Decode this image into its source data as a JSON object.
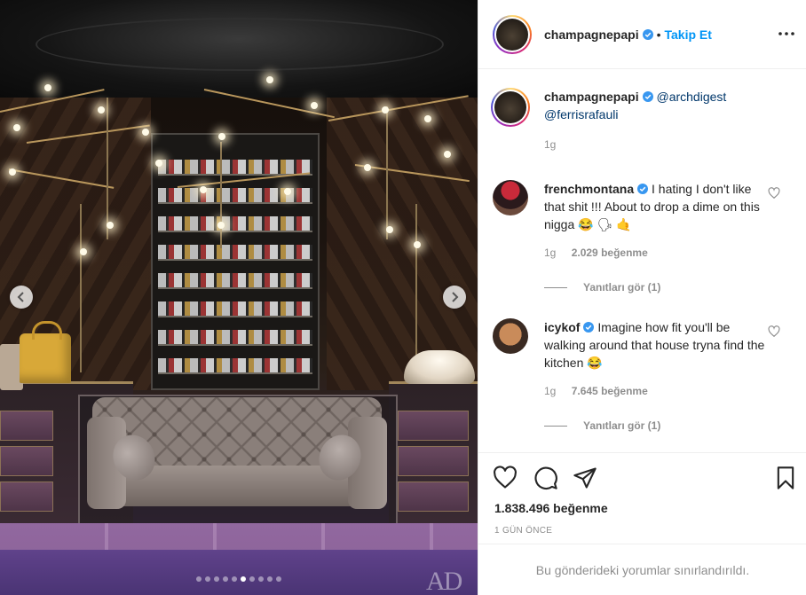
{
  "post": {
    "photo": {
      "watermark": "AD",
      "carousel_count": 10,
      "carousel_active_index": 5,
      "prev_icon": "chevron-left-icon",
      "next_icon": "chevron-right-icon"
    },
    "header": {
      "username": "champagnepapi",
      "separator": "•",
      "follow_label": "Takip Et",
      "more_icon": "more-horizontal-icon"
    },
    "caption": {
      "username": "champagnepapi",
      "mention_1": "@archdigest",
      "mention_2": "@ferrisrafauli",
      "time": "1g"
    },
    "comments": [
      {
        "username": "frenchmontana",
        "text": "I hating I don't like that shit !!! About to drop a dime on this nigga 😂 🗣 🤙",
        "time": "1g",
        "likes": "2.029 beğenme",
        "replies": "Yanıtları gör (1)"
      },
      {
        "username": "icykof",
        "text": "Imagine how fit you'll be walking around that house tryna find the kitchen 😂",
        "time": "1g",
        "likes": "7.645 beğenme",
        "replies": "Yanıtları gör (1)"
      }
    ],
    "actions": {
      "like_icon": "heart-icon",
      "comment_icon": "comment-icon",
      "share_icon": "paper-plane-icon",
      "save_icon": "bookmark-icon",
      "likes_total": "1.838.496 beğenme",
      "time_ago": "1 GÜN ÖNCE"
    },
    "restricted_notice": "Bu gönderideki yorumlar sınırlandırıldı.",
    "colors": {
      "link_blue": "#0095f6",
      "mention_blue": "#00376b",
      "verified_blue": "#3897f0",
      "muted": "#8e8e8e"
    }
  }
}
